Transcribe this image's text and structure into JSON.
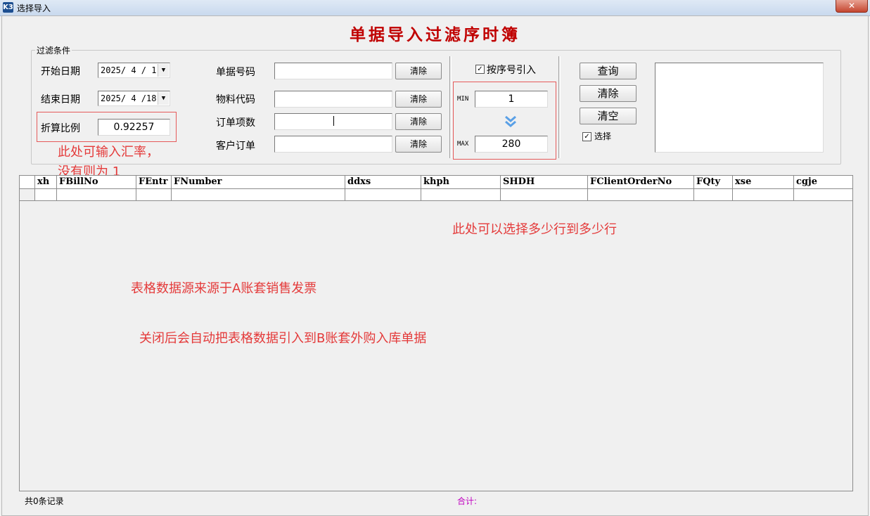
{
  "window": {
    "title": "选择导入",
    "icon": "K3",
    "close_label": "✕"
  },
  "form": {
    "title": "单据导入过滤序时簿"
  },
  "filter": {
    "group_label": "过滤条件",
    "start_date_label": "开始日期",
    "start_date_value": "2025/ 4 / 1",
    "end_date_label": "结束日期",
    "end_date_value": "2025/ 4 /18",
    "ratio_label": "折算比例",
    "ratio_value": "0.92257",
    "bill_no_label": "单据号码",
    "material_code_label": "物料代码",
    "order_items_label": "订单项数",
    "customer_order_label": "客户订单",
    "clear_label": "清除",
    "seq_import_label": "按序号引入",
    "min_label": "MIN",
    "min_value": "1",
    "max_label": "MAX",
    "max_value": "280",
    "query_label": "查询",
    "clear_btn_label": "清除",
    "empty_btn_label": "清空",
    "select_label": "选择"
  },
  "grid": {
    "columns": [
      "xh",
      "FBillNo",
      "FEntr",
      "FNumber",
      "ddxs",
      "khph",
      "SHDH",
      "FClientOrderNo",
      "FQty",
      "xse",
      "cgje"
    ]
  },
  "status": {
    "record_count": "共0条记录",
    "total_label": "合计:"
  },
  "annotations": {
    "note_rate_line1": "此处可输入汇率，",
    "note_rate_line2": "没有则为 1",
    "note_rows": "此处可以选择多少行到多少行",
    "note_source": "表格数据源来源于A账套销售发票",
    "note_close": "关闭后会自动把表格数据引入到B账套外购入库单据"
  },
  "colors": {
    "title_red": "#c00000",
    "annotation_red": "#e43a3a",
    "box_red": "#e55a5a",
    "total_purple": "#c000c0",
    "arrow_blue": "#5aa0e6"
  }
}
